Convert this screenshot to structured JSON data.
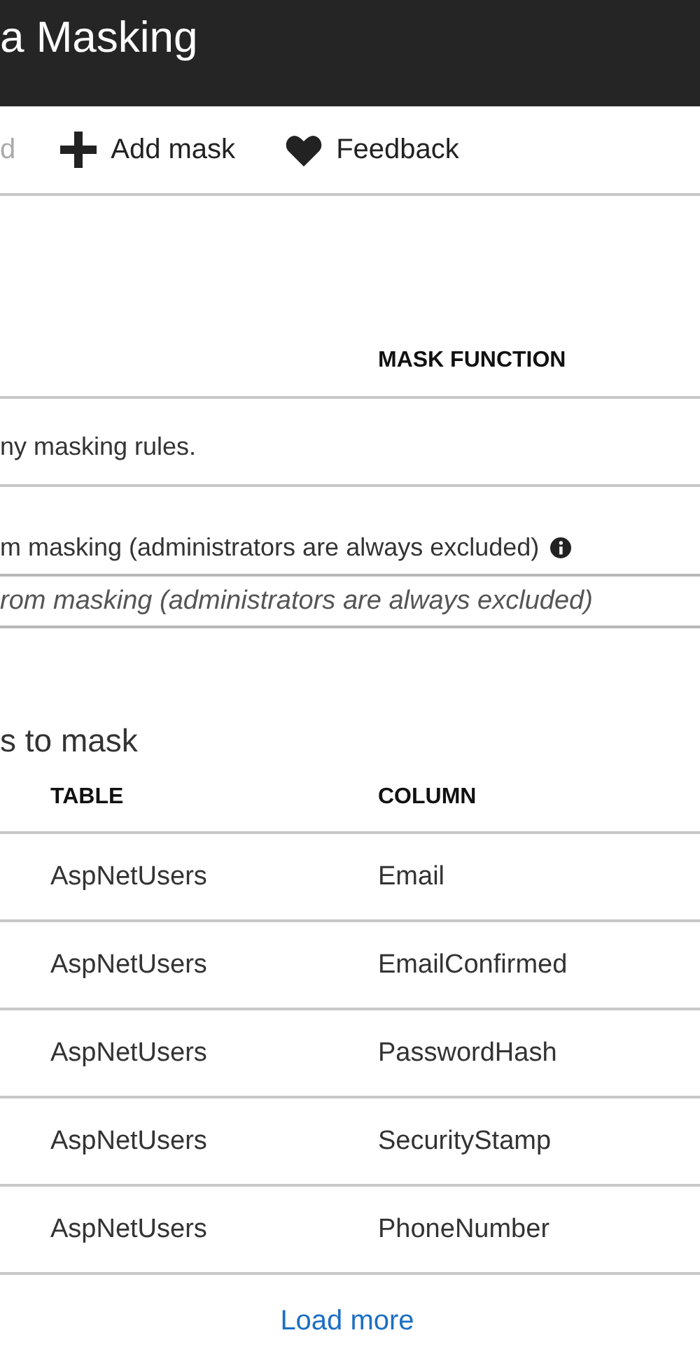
{
  "header": {
    "title": "a Masking"
  },
  "toolbar": [
    {
      "kind": "text",
      "label": "d",
      "disabled": true
    },
    {
      "kind": "add",
      "label": "Add mask",
      "disabled": false
    },
    {
      "kind": "feedback",
      "label": "Feedback",
      "disabled": false
    }
  ],
  "masking_rules": {
    "columns": [
      "MASK FUNCTION"
    ],
    "empty_message": "ny masking rules."
  },
  "excluded_users": {
    "label": "m masking (administrators are always excluded)",
    "placeholder": "rom masking (administrators are always excluded)"
  },
  "recommended": {
    "title": "s to mask",
    "columns": [
      "TABLE",
      "COLUMN"
    ],
    "rows": [
      [
        "AspNetUsers",
        "Email"
      ],
      [
        "AspNetUsers",
        "EmailConfirmed"
      ],
      [
        "AspNetUsers",
        "PasswordHash"
      ],
      [
        "AspNetUsers",
        "SecurityStamp"
      ],
      [
        "AspNetUsers",
        "PhoneNumber"
      ]
    ],
    "load_more": "Load more"
  }
}
